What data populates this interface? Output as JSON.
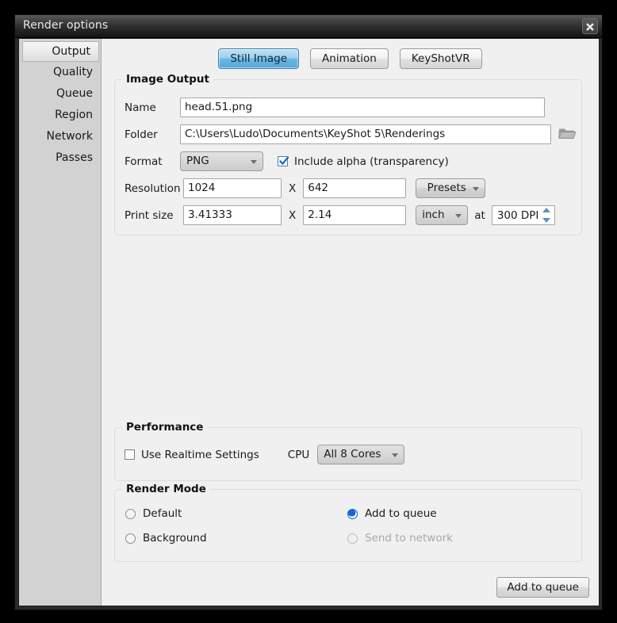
{
  "window": {
    "title": "Render options",
    "close_icon": "close-x-icon"
  },
  "sidebar": {
    "items": [
      {
        "label": "Output",
        "selected": true
      },
      {
        "label": "Quality",
        "selected": false
      },
      {
        "label": "Queue",
        "selected": false
      },
      {
        "label": "Region",
        "selected": false
      },
      {
        "label": "Network",
        "selected": false
      },
      {
        "label": "Passes",
        "selected": false
      }
    ]
  },
  "tabs": [
    {
      "label": "Still Image",
      "active": true
    },
    {
      "label": "Animation",
      "active": false
    },
    {
      "label": "KeyShotVR",
      "active": false
    }
  ],
  "image_output": {
    "legend": "Image Output",
    "name_label": "Name",
    "name_value": "head.51.png",
    "folder_label": "Folder",
    "folder_value": "C:\\Users\\Ludo\\Documents\\KeyShot 5\\Renderings",
    "folder_browse_icon": "folder-icon",
    "format_label": "Format",
    "format_value": "PNG",
    "include_alpha_label": "Include alpha (transparency)",
    "include_alpha_checked": true,
    "resolution_label": "Resolution",
    "resolution_width": "1024",
    "resolution_x": "X",
    "resolution_height": "642",
    "presets_label": "Presets",
    "print_size_label": "Print size",
    "print_width": "3.41333",
    "print_x": "X",
    "print_height": "2.14",
    "print_unit": "inch",
    "at_label": "at",
    "dpi_value": "300 DPI"
  },
  "performance": {
    "legend": "Performance",
    "use_realtime_label": "Use Realtime Settings",
    "use_realtime_checked": false,
    "cpu_label": "CPU",
    "cpu_value": "All 8 Cores"
  },
  "render_mode": {
    "legend": "Render Mode",
    "options": [
      {
        "label": "Default",
        "selected": false,
        "disabled": false
      },
      {
        "label": "Add to queue",
        "selected": true,
        "disabled": false
      },
      {
        "label": "Background",
        "selected": false,
        "disabled": false
      },
      {
        "label": "Send to network",
        "selected": false,
        "disabled": true
      }
    ]
  },
  "footer": {
    "action_label": "Add to queue"
  },
  "colors": {
    "accent_blue": "#1168d8",
    "tab_active": "#6cb6e2",
    "window_bg": "#f0f0f0",
    "sidebar_bg": "#d2d2d2"
  }
}
